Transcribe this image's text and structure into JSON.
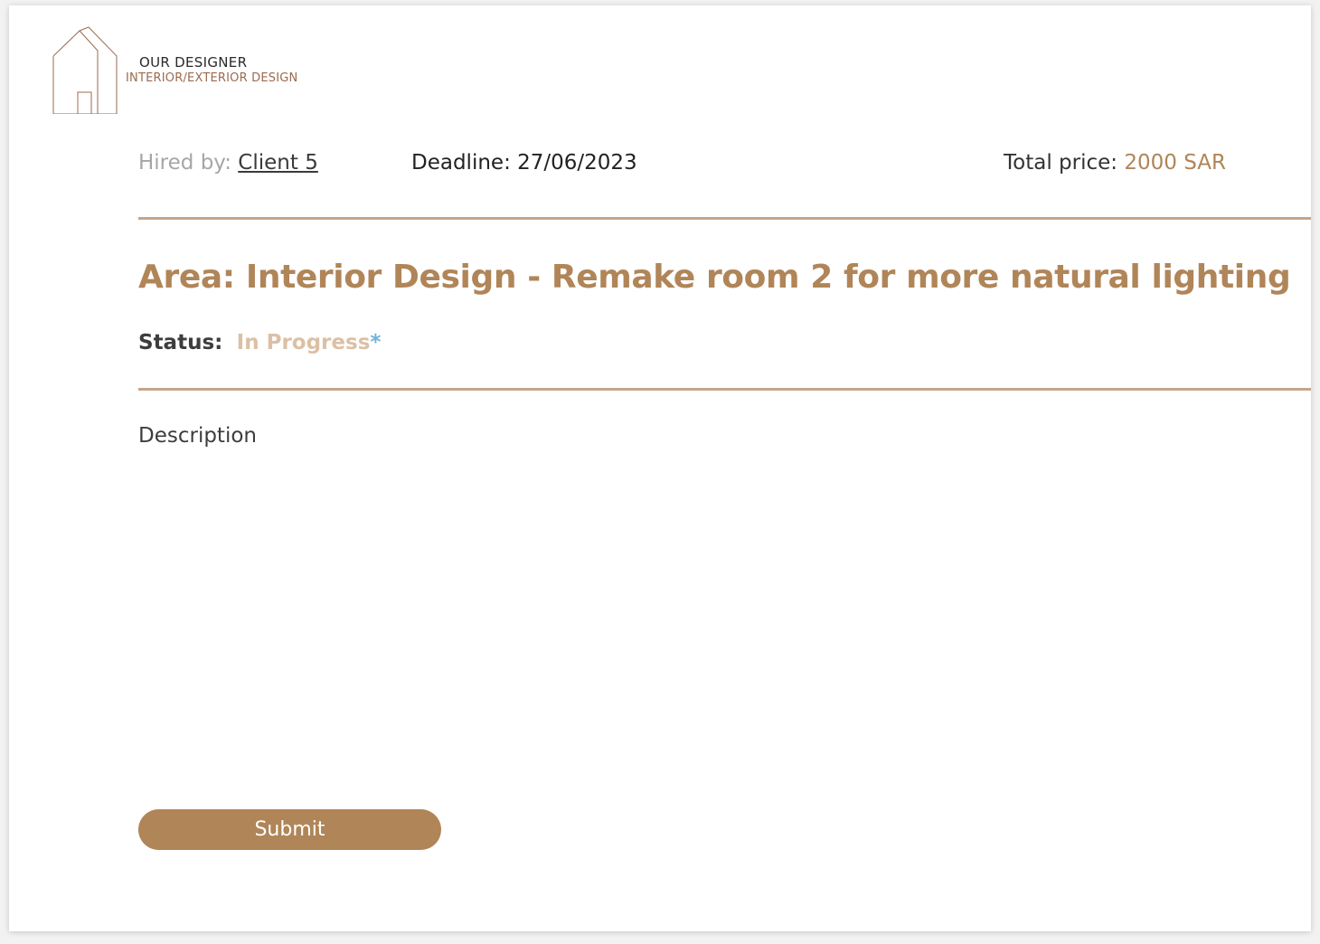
{
  "brand": {
    "logo_icon": "house-outline-icon",
    "title": "OUR DESIGNER",
    "subtitle": "INTERIOR/EXTERIOR DESIGN"
  },
  "meta": {
    "hired_by_label": "Hired by:",
    "client_name": "Client 5",
    "deadline_text": "Deadline: 27/06/2023",
    "total_price_label": "Total price:",
    "total_price_value": "2000 SAR"
  },
  "project": {
    "area_title": "Area: Interior Design - Remake room 2 for more natural lighting",
    "status_label": "Status:",
    "status_value": "In Progress",
    "status_marker": "*"
  },
  "form": {
    "description_label": "Description",
    "description_value": "",
    "submit_label": "Submit"
  },
  "colors": {
    "accent": "#b08558",
    "divider": "#c5a58a",
    "status_text": "#dcc0a5",
    "status_marker": "#6db3d9",
    "logo_line": "#9a6b4e"
  }
}
